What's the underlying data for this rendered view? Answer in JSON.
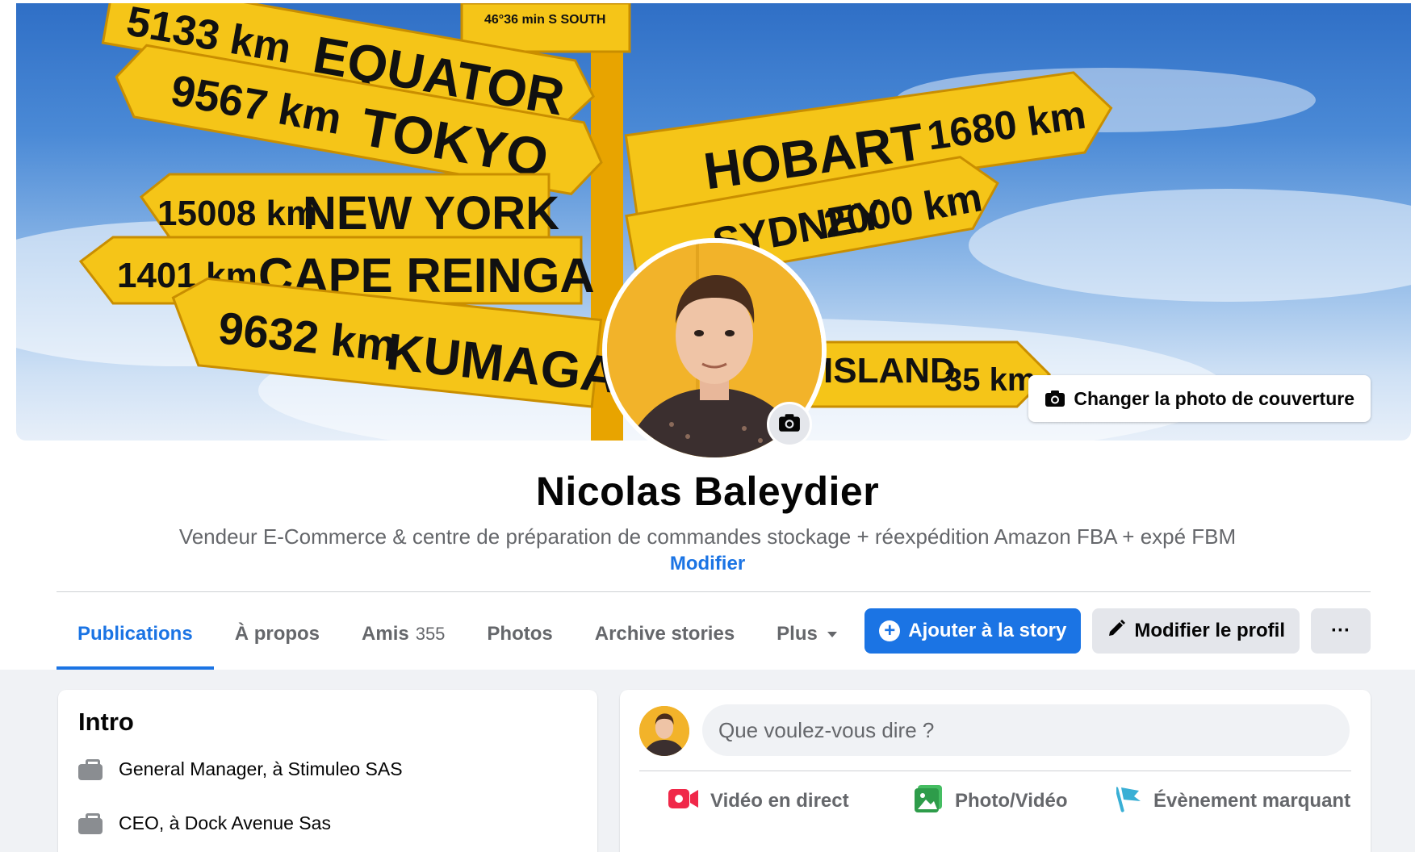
{
  "cover": {
    "change_label": "Changer la photo de couverture",
    "signs": [
      {
        "dist": "5133 km",
        "city": "EQUATOR"
      },
      {
        "dist": "9567 km",
        "city": "TOKYO"
      },
      {
        "dist": "15008 km",
        "city": "NEW YORK"
      },
      {
        "dist": "1401 km",
        "city": "CAPE REINGA"
      },
      {
        "dist": "9632 km",
        "city": "KUMAGAYA"
      },
      {
        "dist": "1680 km",
        "city": "HOBART"
      },
      {
        "dist": "2000 km",
        "city": "SYDNEY"
      },
      {
        "dist": "35 km",
        "city": "ISLAND"
      }
    ],
    "top_sign": "46°36 min S SOUTH"
  },
  "profile": {
    "name": "Nicolas Baleydier",
    "bio": "Vendeur E-Commerce & centre de préparation de commandes stockage + réexpédition Amazon FBA + expé FBM",
    "edit_link": "Modifier"
  },
  "tabs": [
    {
      "label": "Publications",
      "active": true
    },
    {
      "label": "À propos"
    },
    {
      "label": "Amis",
      "count": "355"
    },
    {
      "label": "Photos"
    },
    {
      "label": "Archive stories"
    },
    {
      "label": "Plus"
    }
  ],
  "actions": {
    "add_story": "Ajouter à la story",
    "edit_profile": "Modifier le profil",
    "more": "···"
  },
  "intro": {
    "title": "Intro",
    "items": [
      {
        "icon": "briefcase-icon",
        "text": "General Manager, à Stimuleo SAS"
      },
      {
        "icon": "briefcase-icon",
        "text": "CEO, à Dock Avenue Sas"
      }
    ]
  },
  "composer": {
    "placeholder": "Que voulez-vous dire ?",
    "actions": [
      {
        "label": "Vidéo en direct",
        "icon": "live-video-icon",
        "color": "#f02849"
      },
      {
        "label": "Photo/Vidéo",
        "icon": "photo-video-icon",
        "color": "#45bd62"
      },
      {
        "label": "Évènement marquant",
        "icon": "flag-icon",
        "color": "#39afd5"
      }
    ]
  },
  "colors": {
    "accent": "#1b74e4",
    "sign": "#f5c518"
  }
}
